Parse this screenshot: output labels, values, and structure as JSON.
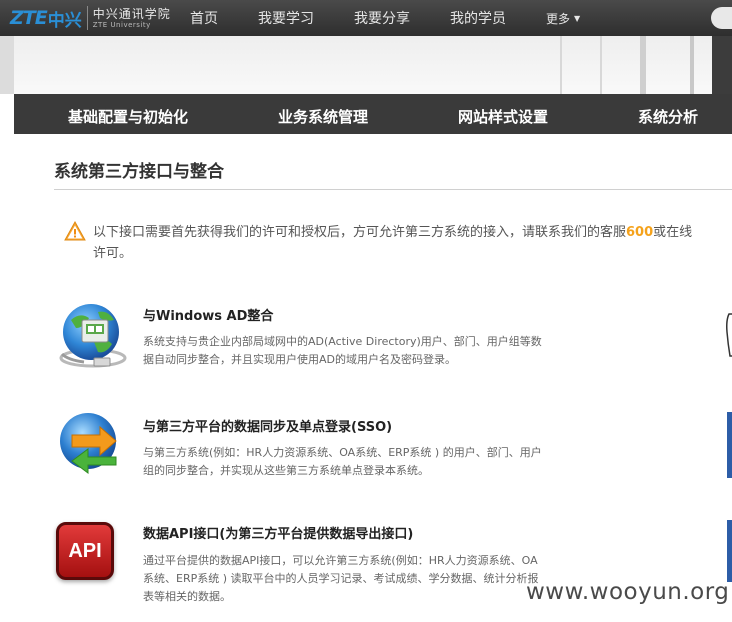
{
  "logo": {
    "brand": "ZTE",
    "brand_cn": "中兴",
    "name_cn": "中兴通讯学院",
    "name_en": "ZTE University"
  },
  "nav": {
    "items": [
      "首页",
      "我要学习",
      "我要分享",
      "我的学员"
    ],
    "more": "更多"
  },
  "subnav": {
    "items": [
      "基础配置与初始化",
      "业务系统管理",
      "网站样式设置",
      "系统分析"
    ]
  },
  "page": {
    "title": "系统第三方接口与整合"
  },
  "notice": {
    "text_before": "以下接口需要首先获得我们的许可和授权后，方可允许第三方系统的接入，请联系我们的客服",
    "phone": "600",
    "text_after": "或在线",
    "line2": "许可。"
  },
  "integrations": [
    {
      "title": "与Windows AD整合",
      "desc": "系统支持与贵企业内部局域网中的AD(Active Directory)用户、部门、用户组等数据自动同步整合，并且实现用户使用AD的域用户名及密码登录。",
      "icon": "network-globe-icon"
    },
    {
      "title": "与第三方平台的数据同步及单点登录(SSO)",
      "desc": "与第三方系统(例如：HR人力资源系统、OA系统、ERP系统 ) 的用户、部门、用户组的同步整合，并实现从这些第三方系统单点登录本系统。",
      "icon": "sync-arrows-icon"
    },
    {
      "title": "数据API接口(为第三方平台提供数据导出接口)",
      "desc": "通过平台提供的数据API接口，可以允许第三方系统(例如：HR人力资源系统、OA系统、ERP系统 ) 读取平台中的人员学习记录、考试成绩、学分数据、统计分析报表等相关的数据。",
      "icon": "api-icon",
      "badge": "API"
    }
  ],
  "watermark": "www.wooyun.org",
  "colors": {
    "nav_bg": "#333333",
    "subnav_bg": "#3a3a3a",
    "accent_orange": "#f5a21b",
    "brand_blue": "#2a8fd6"
  }
}
